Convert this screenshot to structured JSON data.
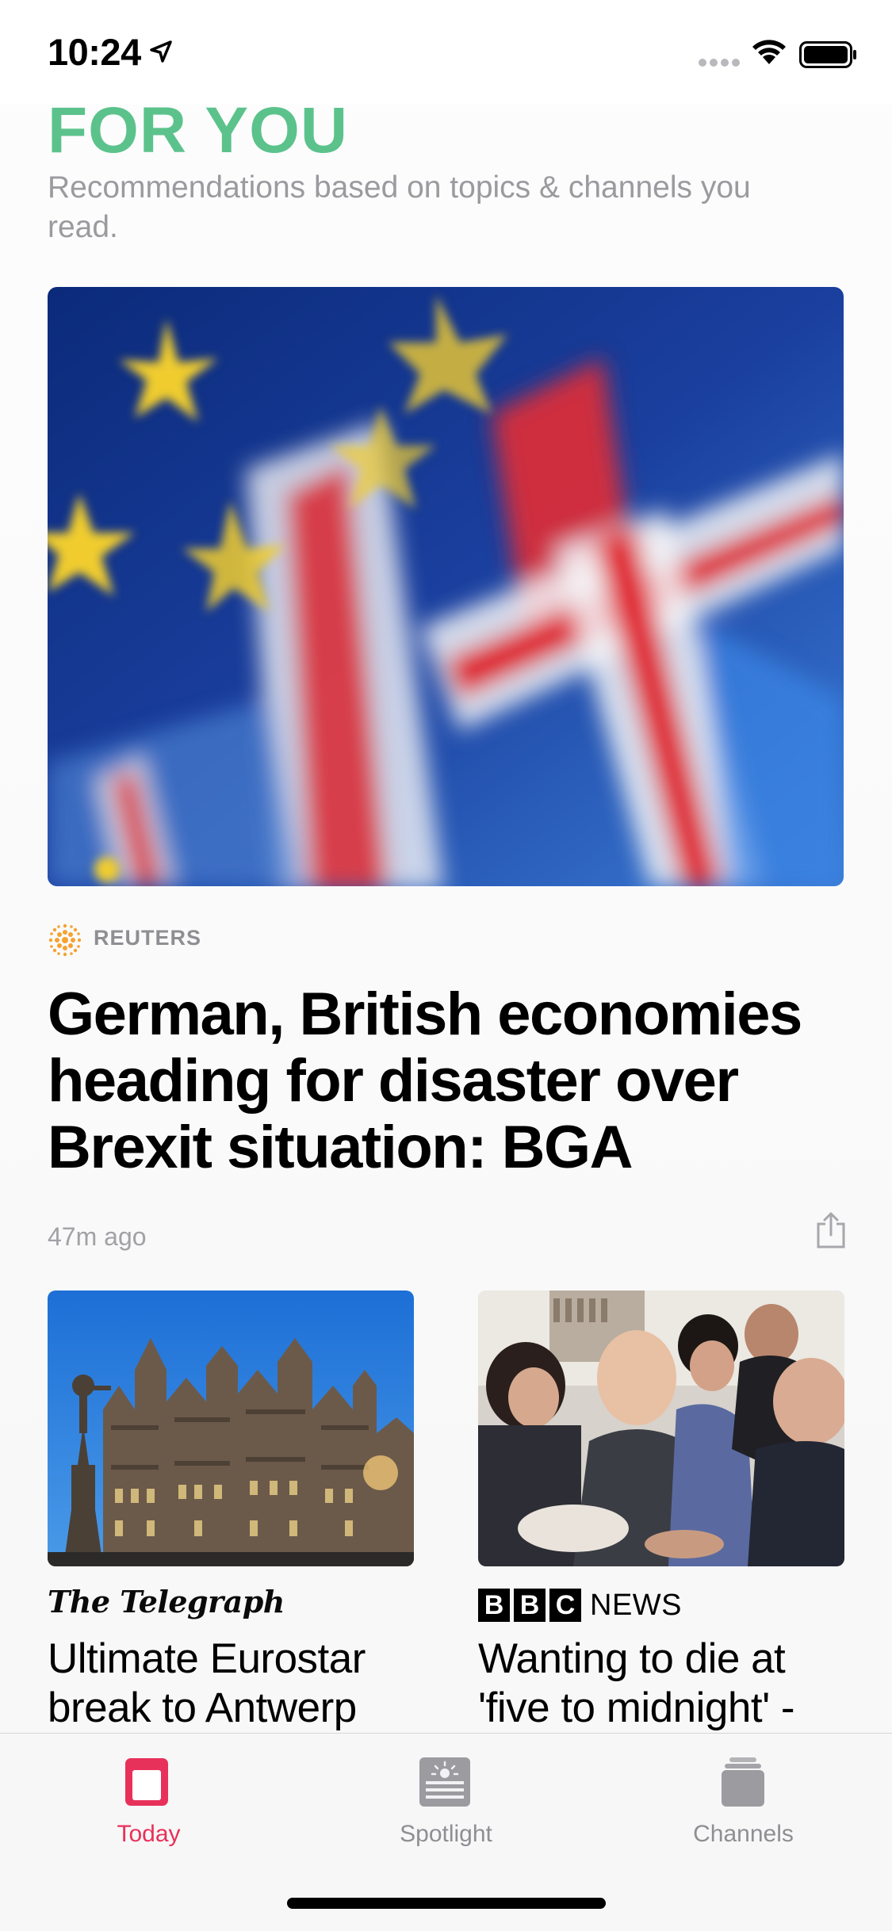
{
  "status_bar": {
    "time": "10:24",
    "icons": [
      "location-arrow-icon",
      "cellular-signal-icon",
      "wifi-icon",
      "battery-icon"
    ]
  },
  "header": {
    "title": "FOR YOU",
    "subtitle": "Recommendations based on topics & channels you read."
  },
  "hero_story": {
    "image": "eu-and-union-jack-flags-photo",
    "publisher": "REUTERS",
    "headline": "German, British economies heading for disaster over Brexit situation: BGA",
    "time_ago": "47m ago"
  },
  "cards": [
    {
      "image": "antwerp-guild-houses-photo",
      "publisher": "The Telegraph",
      "headline": "Ultimate Eurostar break to Antwerp"
    },
    {
      "image": "group-of-people-photo",
      "publisher_letters": [
        "B",
        "B",
        "C"
      ],
      "publisher_suffix": "NEWS",
      "headline": "Wanting to die at 'five to midnight' -"
    }
  ],
  "tab_bar": {
    "tabs": [
      {
        "label": "Today",
        "icon": "today-icon",
        "active": true
      },
      {
        "label": "Spotlight",
        "icon": "spotlight-icon",
        "active": false
      },
      {
        "label": "Channels",
        "icon": "channels-icon",
        "active": false
      }
    ]
  },
  "colors": {
    "title_green": "#5cc28c",
    "active_tab_red": "#e8315a",
    "secondary_gray": "#8e8e93"
  }
}
